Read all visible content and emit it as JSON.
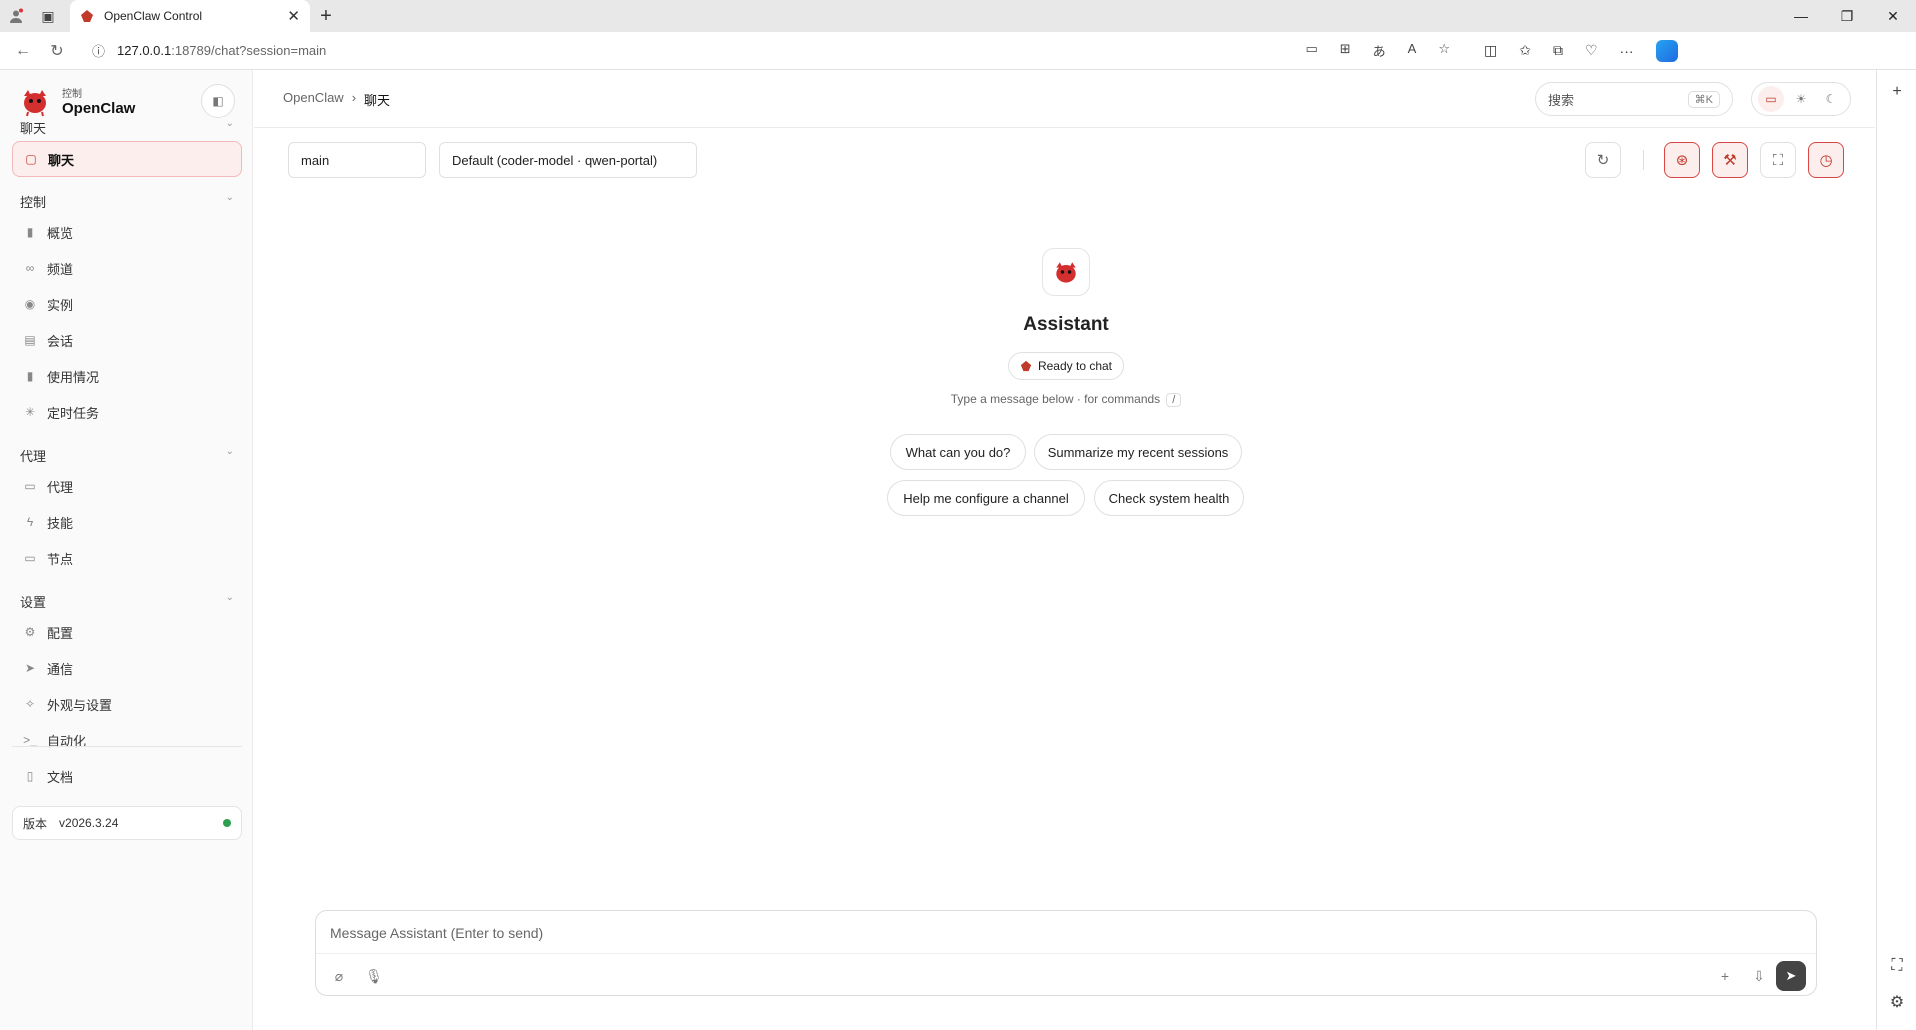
{
  "browser": {
    "tab_title": "OpenClaw Control",
    "url_host": "127.0.0.1",
    "url_rest": ":18789/chat?session=main"
  },
  "sidebar": {
    "brand_sub": "控制",
    "brand_name": "OpenClaw",
    "sections": [
      {
        "title": "聊天",
        "items": [
          {
            "label": "聊天",
            "icon": "chat-icon",
            "active": true
          }
        ]
      },
      {
        "title": "控制",
        "items": [
          {
            "label": "概览",
            "icon": "bar-chart-icon"
          },
          {
            "label": "频道",
            "icon": "link-icon"
          },
          {
            "label": "实例",
            "icon": "radio-icon"
          },
          {
            "label": "会话",
            "icon": "file-icon"
          },
          {
            "label": "使用情况",
            "icon": "bar-chart-icon"
          },
          {
            "label": "定时任务",
            "icon": "loader-icon"
          }
        ]
      },
      {
        "title": "代理",
        "items": [
          {
            "label": "代理",
            "icon": "folder-icon"
          },
          {
            "label": "技能",
            "icon": "zap-icon"
          },
          {
            "label": "节点",
            "icon": "monitor-icon"
          }
        ]
      },
      {
        "title": "设置",
        "items": [
          {
            "label": "配置",
            "icon": "gear-icon"
          },
          {
            "label": "通信",
            "icon": "send-icon"
          },
          {
            "label": "外观与设置",
            "icon": "sparkle-icon"
          },
          {
            "label": "自动化",
            "icon": "terminal-icon"
          }
        ]
      }
    ],
    "docs_label": "文档",
    "version_label": "版本",
    "version_value": "v2026.3.24"
  },
  "header": {
    "breadcrumb_root": "OpenClaw",
    "breadcrumb_sep": "›",
    "breadcrumb_current": "聊天",
    "search_placeholder": "搜索",
    "search_shortcut": "⌘K"
  },
  "chat": {
    "session_value": "main",
    "model_value": "Default (coder-model · qwen-portal)",
    "assistant_name": "Assistant",
    "status_text": "Ready to chat",
    "hint_text": "Type a message below · for commands",
    "hint_key": "/",
    "suggestions": [
      "What can you do?",
      "Summarize my recent sessions",
      "Help me configure a channel",
      "Check system health"
    ],
    "composer_placeholder": "Message Assistant (Enter to send)"
  },
  "colors": {
    "accent": "#c0392b",
    "accent_bg": "#fdeeee",
    "status_green": "#2e9e4f"
  }
}
